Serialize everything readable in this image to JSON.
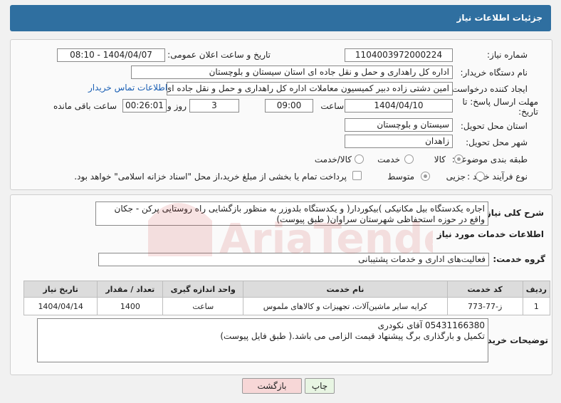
{
  "header": {
    "title": "جزئیات اطلاعات نیاز"
  },
  "need": {
    "number_label": "شماره نیاز:",
    "number": "1104003972000224",
    "announce_label": "تاریخ و ساعت اعلان عمومی:",
    "announce_value": "1404/04/07 - 08:10",
    "buyer_label": "نام دستگاه خریدار:",
    "buyer": "اداره کل راهداری و حمل و نقل جاده ای استان سیستان و بلوچستان",
    "creator_label": "ایجاد کننده درخواست:",
    "creator": "امین دشتی زاده دبیر کمیسیون معاملات اداره کل راهداری و حمل و نقل جاده ای",
    "contact_link": "اطلاعات تماس خریدار",
    "deadline_label": "مهلت ارسال پاسخ: تا تاریخ:",
    "deadline_date": "1404/04/10",
    "time_label": "ساعت",
    "deadline_time": "09:00",
    "days_value": "3",
    "days_label": "روز و",
    "remaining_time": "00:26:01",
    "remaining_label": "ساعت باقی مانده",
    "province_label": "استان محل تحویل:",
    "province": "سیستان و بلوچستان",
    "city_label": "شهر محل تحویل:",
    "city": "زاهدان",
    "category_label": "طبقه بندی موضوعی:",
    "category_options": [
      "کالا",
      "خدمت",
      "کالا/خدمت"
    ],
    "purchase_label": "نوع فرآیند خرید :",
    "purchase_options": [
      "جزیی",
      "متوسط"
    ],
    "payment_note": "پرداخت تمام یا بخشی از مبلغ خرید،از محل \"اسناد خزانه اسلامی\" خواهد بود."
  },
  "summary": {
    "label": "شرح کلی نیاز:",
    "text": "اجاره یکدستگاه بیل مکانیکی )بیکوردار( و یکدستگاه بلدوزر به منظور بازگشایی راه روستایی پرکن - جکان واقع در حوزه استحفاظی شهرستان سراوان( طبق پیوست)"
  },
  "services": {
    "section_title": "اطلاعات خدمات مورد نیاز",
    "group_label": "گروه خدمت:",
    "group_value": "فعالیت‌های اداری و خدمات پشتیبانی",
    "columns": [
      "ردیف",
      "کد خدمت",
      "نام خدمت",
      "واحد اندازه گیری",
      "تعداد / مقدار",
      "تاریخ نیاز"
    ],
    "rows": [
      [
        "1",
        "ز-77-773",
        "کرایه سایر ماشین‌آلات، تجهیزات و کالاهای ملموس",
        "ساعت",
        "1400",
        "1404/04/14"
      ]
    ]
  },
  "buyer_notes": {
    "label": "توضیحات خریدار:",
    "line1": "05431166380 آقای نکودری",
    "line2": "تکمیل و بارگذاری برگ پیشنهاد قیمت الزامی می باشد.( طبق فایل پیوست)"
  },
  "actions": {
    "print": "چاپ",
    "back": "بازگشت"
  },
  "watermark": {
    "text": "AriaTender.neT"
  },
  "colors": {
    "header": "#2f6fa0",
    "link": "#1a5fb4",
    "back_button": "#f7d7d7",
    "print_button": "#e8f5e3"
  }
}
